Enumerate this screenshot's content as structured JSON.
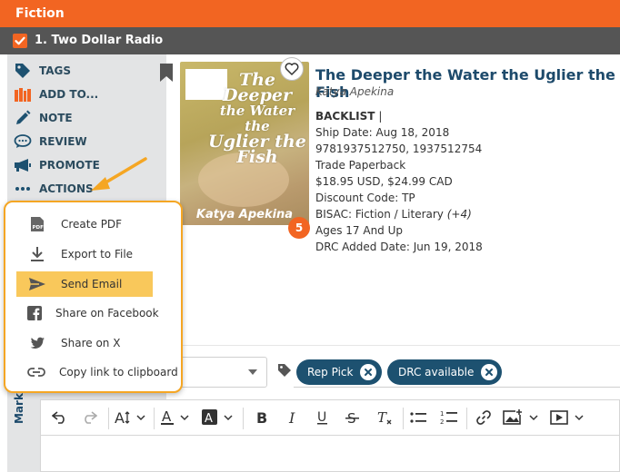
{
  "header": {
    "title": "Fiction"
  },
  "group": {
    "label": "1. Two Dollar Radio",
    "checked": true
  },
  "sidebar": {
    "items": [
      {
        "label": "TAGS",
        "icon": "tag-icon"
      },
      {
        "label": "ADD TO...",
        "icon": "books-icon"
      },
      {
        "label": "NOTE",
        "icon": "pencil-icon"
      },
      {
        "label": "REVIEW",
        "icon": "speech-bubble-icon"
      },
      {
        "label": "PROMOTE",
        "icon": "megaphone-icon"
      },
      {
        "label": "ACTIONS",
        "icon": "ellipsis-icon"
      }
    ],
    "vertical_label": "Mark"
  },
  "actions_menu": {
    "items": [
      {
        "label": "Create PDF",
        "icon": "pdf-icon"
      },
      {
        "label": "Export to File",
        "icon": "download-icon"
      },
      {
        "label": "Send Email",
        "icon": "send-icon",
        "highlighted": true
      },
      {
        "label": "Share on Facebook",
        "icon": "facebook-icon"
      },
      {
        "label": "Share on X",
        "icon": "twitter-icon"
      },
      {
        "label": "Copy link to clipboard",
        "icon": "link-icon"
      }
    ]
  },
  "book": {
    "title": "The Deeper the Water the Uglier the Fish",
    "author": "Katya Apekina",
    "status": "BACKLIST",
    "status_sep": "|",
    "ship_date": "Ship Date: Aug 18, 2018",
    "isbns": "9781937512750, 1937512754",
    "format": "Trade Paperback",
    "price": "$18.95 USD, $24.99 CAD",
    "discount": "Discount Code: TP",
    "bisac": "BISAC: Fiction / Literary",
    "bisac_more": "(+4)",
    "ages": "Ages 17 And Up",
    "drc_date": "DRC Added Date: Jun 19, 2018",
    "review_count": "5",
    "cover": {
      "title_line1": "The",
      "title_line2": "Deeper",
      "title_line3": "the Water the",
      "title_line4": "Uglier the",
      "title_line5": "Fish",
      "author": "Katya Apekina"
    }
  },
  "tags": {
    "chips": [
      {
        "label": "Rep Pick"
      },
      {
        "label": "DRC available"
      }
    ]
  },
  "colors": {
    "brand_orange": "#f26522",
    "chip_blue": "#1d5170",
    "highlight": "#f9c85b",
    "menu_border": "#f5a623"
  }
}
